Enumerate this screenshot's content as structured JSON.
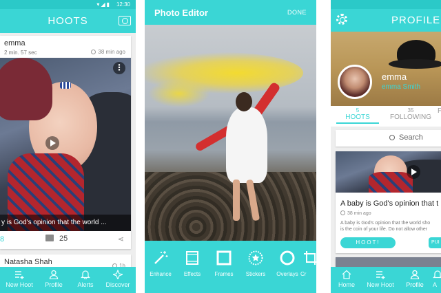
{
  "colors": {
    "accent": "#3ad6d5",
    "status_bar": "#2bc9c8",
    "text_dark": "#333333"
  },
  "screen1": {
    "status_time": "12:30",
    "title": "HOOTS",
    "camera_icon": "camera-icon",
    "post1": {
      "user": "emma",
      "duration": "2 min. 57 sec",
      "ago": "38 min ago",
      "caption": "y is God's opinion that the world ...",
      "comments": "25",
      "likes_partial": "8"
    },
    "post2": {
      "user": "Natasha Shah",
      "ago_partial": "1h"
    },
    "tabs": [
      {
        "label": "New Hoot",
        "icon": "new-hoot-icon"
      },
      {
        "label": "Profile",
        "icon": "profile-icon"
      },
      {
        "label": "Alerts",
        "icon": "bell-icon"
      },
      {
        "label": "Discover",
        "icon": "compass-icon"
      }
    ]
  },
  "screen2": {
    "title": "Photo Editor",
    "done": "DONE",
    "tools": [
      {
        "label": "Enhance",
        "icon": "magic-wand-icon"
      },
      {
        "label": "Effects",
        "icon": "film-icon"
      },
      {
        "label": "Frames",
        "icon": "frame-icon"
      },
      {
        "label": "Stickers",
        "icon": "star-badge-icon"
      },
      {
        "label": "Overlays",
        "icon": "circle-overlay-icon"
      },
      {
        "label": "Cr",
        "icon": "crop-icon"
      }
    ]
  },
  "screen3": {
    "title": "PROFILE",
    "name": "emma",
    "full_name": "emma Smith",
    "stats": [
      {
        "num": "5",
        "label": "HOOTS"
      },
      {
        "num": "35",
        "label": "FOLLOWING"
      },
      {
        "num": "",
        "label": "F"
      }
    ],
    "search_placeholder": "Search",
    "post": {
      "title": "A baby is God's opinion that t",
      "ago": "38 min ago",
      "body_line1": "A baby is God's opinion that the world sho",
      "body_line2": "is the coin of your life. Do not allow other",
      "hoot_button": "HOOT!",
      "publish_partial": "PUI"
    },
    "tabs": [
      {
        "label": "Home",
        "icon": "home-icon"
      },
      {
        "label": "New Hoot",
        "icon": "new-hoot-icon"
      },
      {
        "label": "Profile",
        "icon": "profile-icon"
      },
      {
        "label": "A",
        "icon": "bell-icon"
      }
    ]
  }
}
